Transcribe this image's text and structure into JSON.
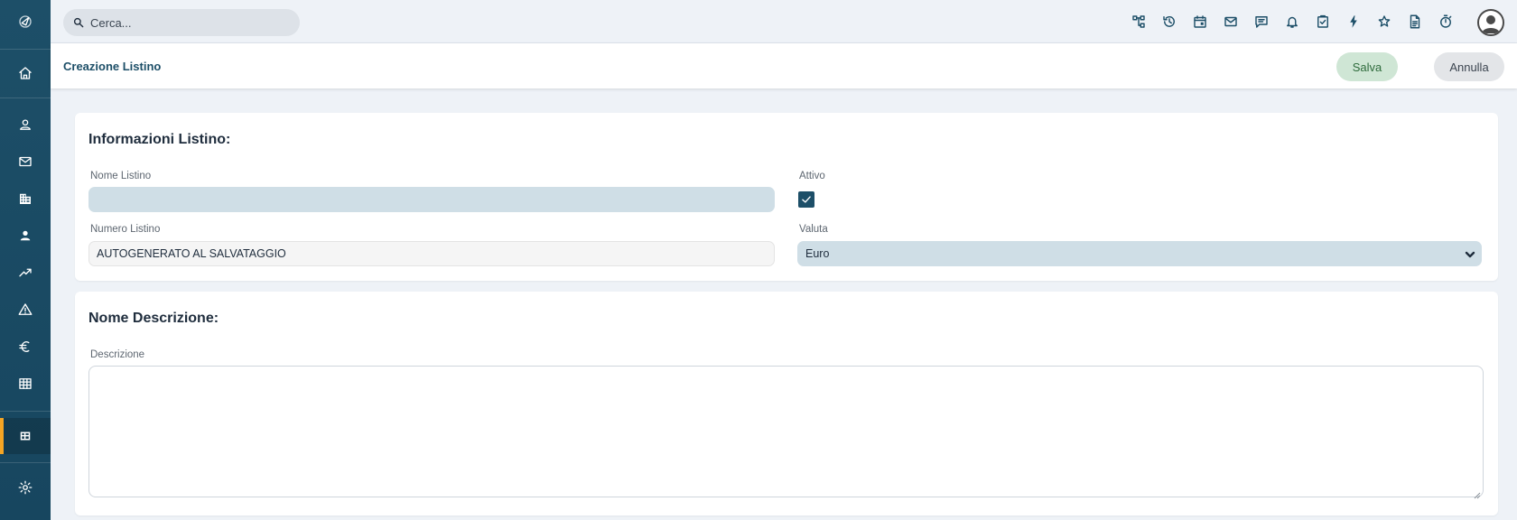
{
  "topbar": {
    "search_placeholder": "Cerca...",
    "icons": [
      "hierarchy-icon",
      "history-icon",
      "calendar-icon",
      "mail-icon",
      "chat-icon",
      "bell-icon",
      "task-check-icon",
      "bolt-icon",
      "star-icon",
      "document-icon",
      "timer-icon"
    ]
  },
  "sidebar": {
    "items": [
      "home-icon",
      "person-outline-icon",
      "mail-icon",
      "building-icon",
      "person-icon",
      "trending-up-icon",
      "warning-icon",
      "euro-icon",
      "table-icon",
      "grid-icon",
      "gear-icon"
    ],
    "active_item": "grid-icon",
    "accent_color": "#f5a524"
  },
  "header": {
    "title": "Creazione Listino",
    "save_label": "Salva",
    "cancel_label": "Annulla"
  },
  "info_section": {
    "title": "Informazioni Listino:",
    "name_label": "Nome Listino",
    "name_value": "",
    "active_label": "Attivo",
    "active_checked": true,
    "number_label": "Numero Listino",
    "number_value": "AUTOGENERATO AL SALVATAGGIO",
    "currency_label": "Valuta",
    "currency_value": "Euro"
  },
  "description_section": {
    "title": "Nome Descrizione:",
    "description_label": "Descrizione",
    "description_value": ""
  },
  "colors": {
    "sidebar_bg": "#1d4f68",
    "primary": "#1d4f68",
    "save_bg": "#cfe6d5",
    "cancel_bg": "#e3e5e8",
    "field_bg": "#cfdee6"
  }
}
